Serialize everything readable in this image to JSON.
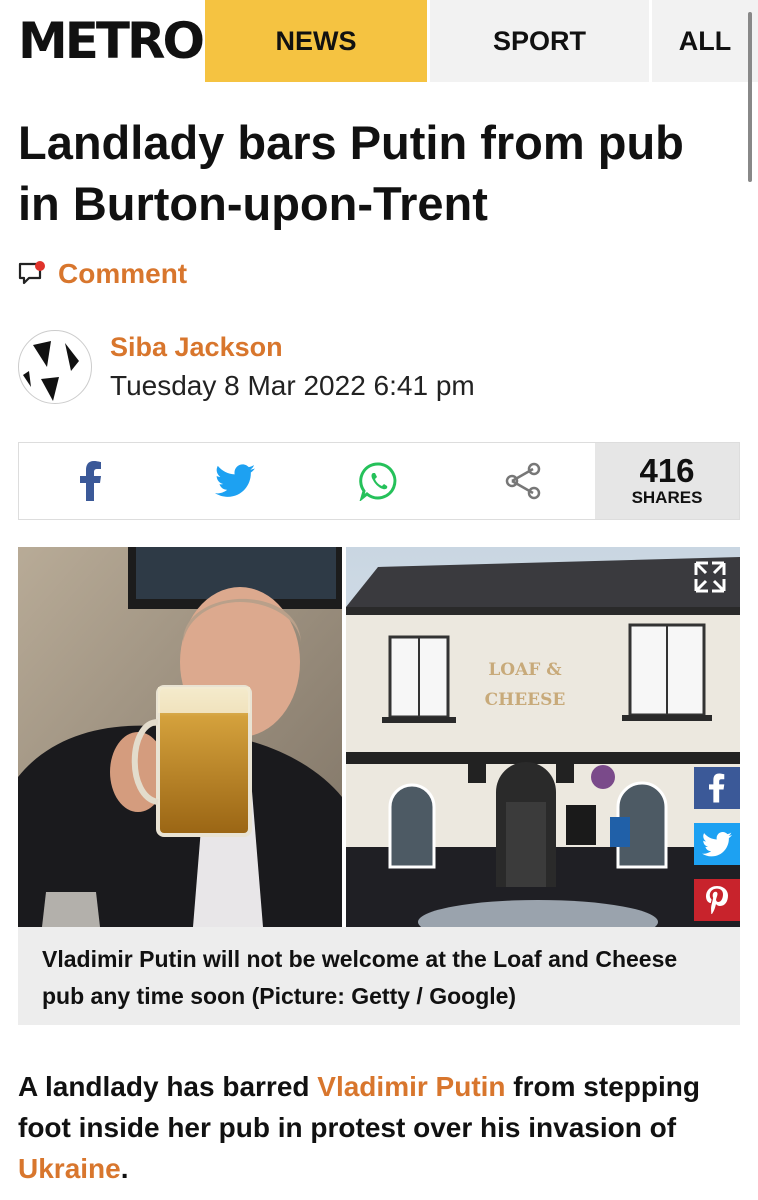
{
  "nav": {
    "logo": "METRO",
    "items": [
      "NEWS",
      "SPORT",
      "ALL"
    ],
    "active_color": "#f5c341"
  },
  "article": {
    "headline": "Landlady bars Putin from pub in Burton-upon-Trent",
    "comment_label": "Comment",
    "author": "Siba Jackson",
    "date": "Tuesday 8 Mar 2022 6:41 pm",
    "accent_color": "#d8762d"
  },
  "share": {
    "count": "416",
    "label": "SHARES",
    "icons": [
      "facebook-icon",
      "twitter-icon",
      "whatsapp-icon",
      "share-icon"
    ]
  },
  "image": {
    "pub_sign": [
      "LOAF &",
      "CHEESE"
    ],
    "caption": "Vladimir Putin will not be welcome at the Loaf and Cheese pub any time soon (Picture: Getty / Google)"
  },
  "body": {
    "lead_1": "A landlady has barred ",
    "lead_link_1": "Vladimir Putin",
    "lead_2": " from stepping foot inside her pub in protest over his invasion of ",
    "lead_link_2": "Ukraine",
    "lead_3": "."
  }
}
